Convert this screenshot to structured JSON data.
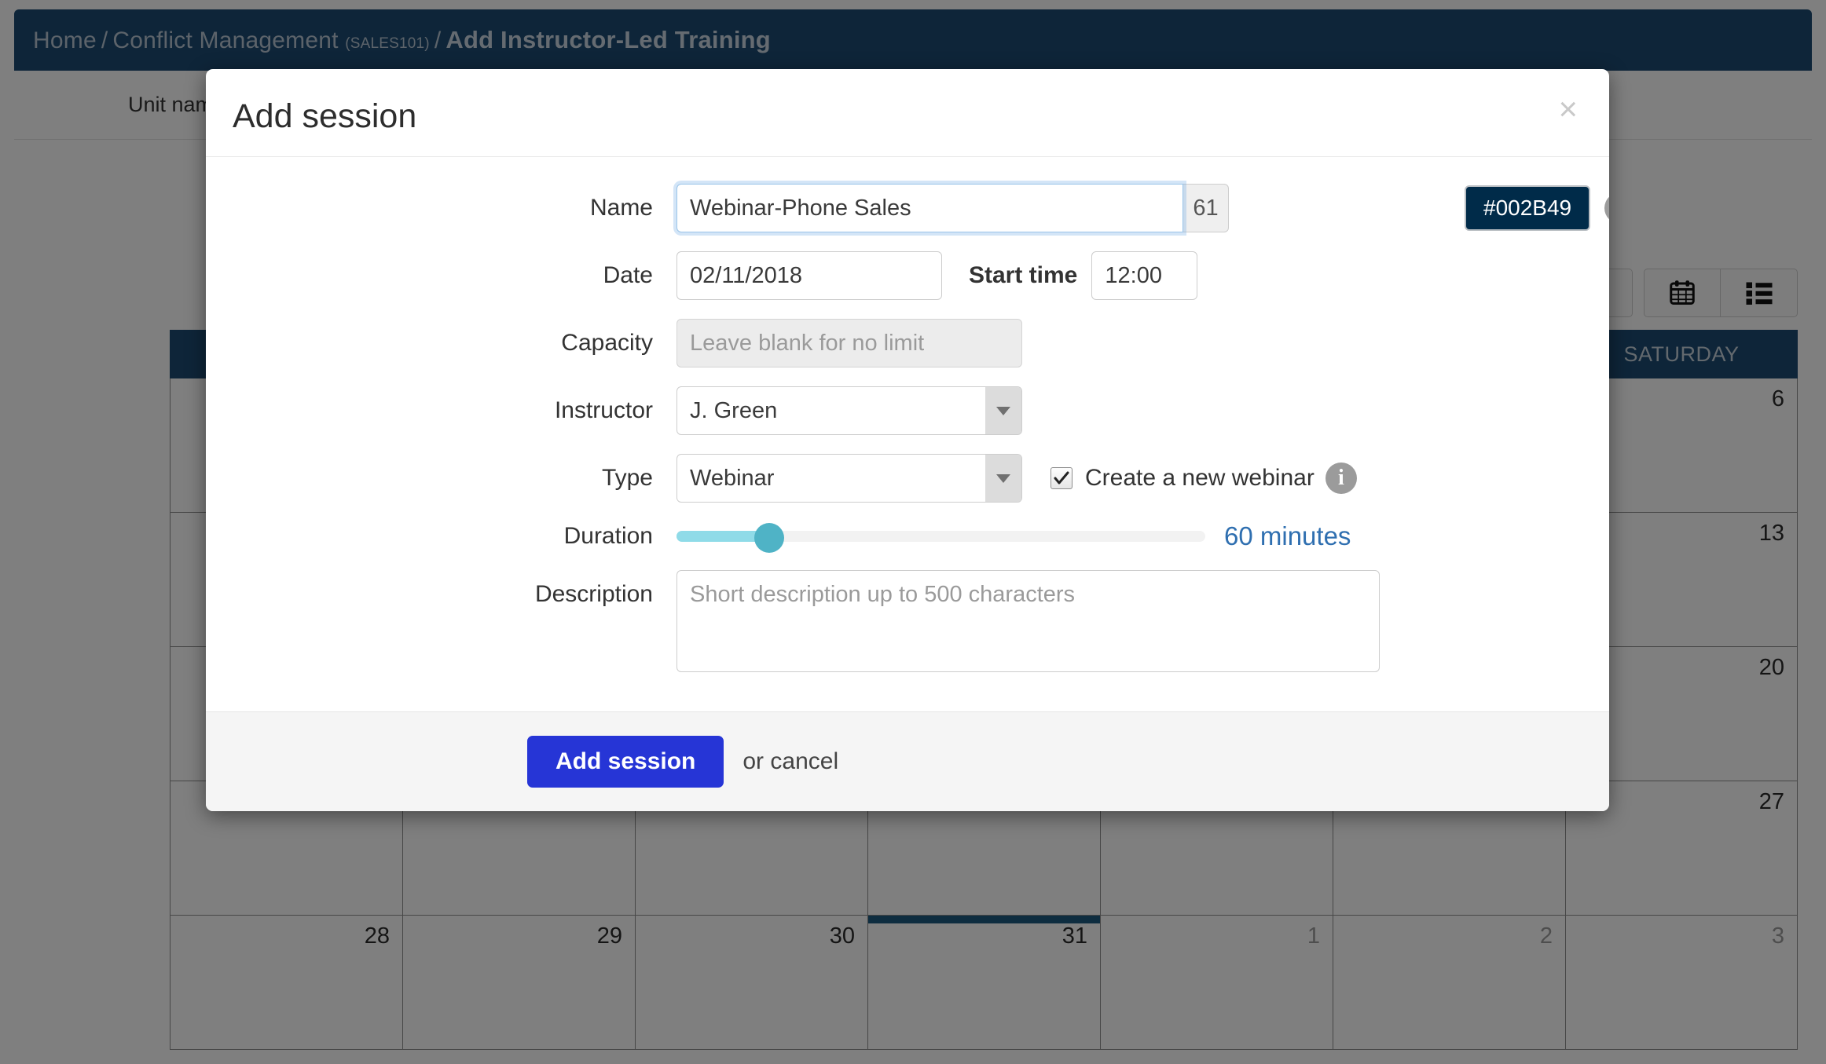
{
  "header": {
    "breadcrumb_home": "Home",
    "breadcrumb_sep1": "/",
    "breadcrumb_course": "Conflict Management",
    "breadcrumb_course_code": "(SALES101)",
    "breadcrumb_sep2": "/",
    "breadcrumb_current": "Add Instructor-Led Training"
  },
  "background": {
    "unit_label": "Unit nam",
    "prev_icon": "chevron-left-icon",
    "calendar_view_icon": "calendar-icon",
    "list_view_icon": "list-icon",
    "day_headers": [
      "",
      "",
      "",
      "",
      "",
      "",
      "SATURDAY"
    ],
    "weeks": [
      [
        {
          "num": "",
          "muted": false,
          "today": false
        },
        {
          "num": "",
          "muted": false,
          "today": false
        },
        {
          "num": "",
          "muted": false,
          "today": false
        },
        {
          "num": "",
          "muted": false,
          "today": false
        },
        {
          "num": "",
          "muted": false,
          "today": false
        },
        {
          "num": "",
          "muted": false,
          "today": false
        },
        {
          "num": "6",
          "muted": false,
          "today": false
        }
      ],
      [
        {
          "num": "",
          "muted": false,
          "today": false
        },
        {
          "num": "",
          "muted": false,
          "today": false
        },
        {
          "num": "",
          "muted": false,
          "today": false
        },
        {
          "num": "",
          "muted": false,
          "today": false
        },
        {
          "num": "",
          "muted": false,
          "today": false
        },
        {
          "num": "",
          "muted": false,
          "today": false
        },
        {
          "num": "13",
          "muted": false,
          "today": false
        }
      ],
      [
        {
          "num": "",
          "muted": false,
          "today": false
        },
        {
          "num": "",
          "muted": false,
          "today": false
        },
        {
          "num": "",
          "muted": false,
          "today": false
        },
        {
          "num": "",
          "muted": false,
          "today": false
        },
        {
          "num": "",
          "muted": false,
          "today": false
        },
        {
          "num": "",
          "muted": false,
          "today": false
        },
        {
          "num": "20",
          "muted": false,
          "today": false
        }
      ],
      [
        {
          "num": "",
          "muted": false,
          "today": false
        },
        {
          "num": "",
          "muted": false,
          "today": false
        },
        {
          "num": "",
          "muted": false,
          "today": false
        },
        {
          "num": "",
          "muted": false,
          "today": false
        },
        {
          "num": "",
          "muted": false,
          "today": false
        },
        {
          "num": "",
          "muted": false,
          "today": false
        },
        {
          "num": "27",
          "muted": false,
          "today": false
        }
      ],
      [
        {
          "num": "28",
          "muted": false,
          "today": false
        },
        {
          "num": "29",
          "muted": false,
          "today": false
        },
        {
          "num": "30",
          "muted": false,
          "today": false
        },
        {
          "num": "31",
          "muted": false,
          "today": true
        },
        {
          "num": "1",
          "muted": true,
          "today": false
        },
        {
          "num": "2",
          "muted": true,
          "today": false
        },
        {
          "num": "3",
          "muted": true,
          "today": false
        }
      ]
    ]
  },
  "modal": {
    "title": "Add session",
    "close_label": "×",
    "fields": {
      "name": {
        "label": "Name",
        "value": "Webinar-Phone Sales",
        "char_count": "61"
      },
      "color_badge": {
        "value": "#002B49",
        "info_icon": "info-icon"
      },
      "date": {
        "label": "Date",
        "value": "02/11/2018"
      },
      "start_time": {
        "label": "Start time",
        "value": "12:00"
      },
      "capacity": {
        "label": "Capacity",
        "value": "",
        "placeholder": "Leave blank for no limit"
      },
      "instructor": {
        "label": "Instructor",
        "value": "J. Green",
        "options": [
          "J. Green"
        ]
      },
      "type": {
        "label": "Type",
        "value": "Webinar",
        "options": [
          "Webinar"
        ]
      },
      "create_webinar": {
        "label": "Create a new webinar",
        "checked": true,
        "info_icon": "info-icon"
      },
      "duration": {
        "label": "Duration",
        "value_label": "60 minutes",
        "percent": 17.6
      },
      "description": {
        "label": "Description",
        "value": "",
        "placeholder": "Short description up to 500 characters"
      }
    },
    "footer": {
      "submit_label": "Add session",
      "cancel_text": "or cancel"
    }
  },
  "colors": {
    "brand_navy": "#1c4b72",
    "badge_navy": "#002B49",
    "primary_button": "#2635D6",
    "slider_fill": "#8FDBE8",
    "slider_knob": "#4FB3C6",
    "duration_text": "#2F6FB0"
  }
}
